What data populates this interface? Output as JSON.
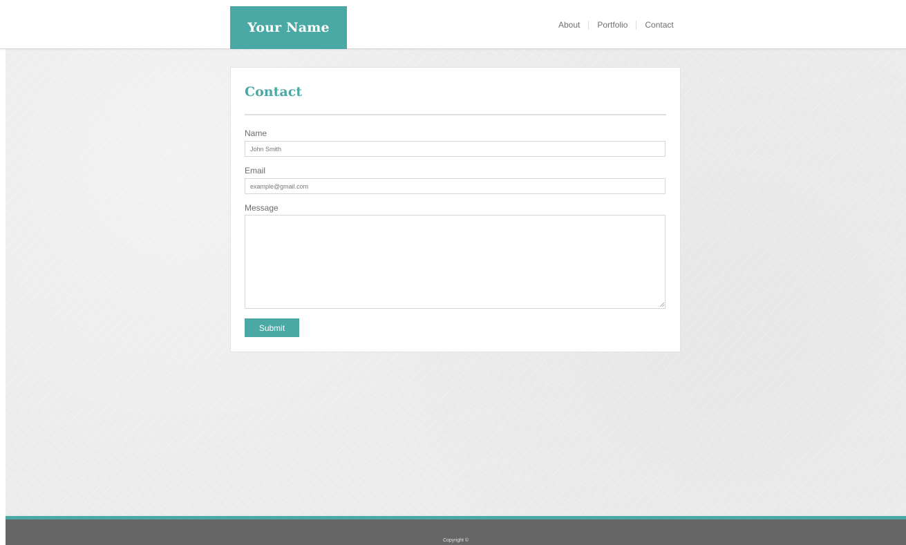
{
  "header": {
    "logo_text": "Your Name",
    "nav": [
      {
        "label": "About"
      },
      {
        "label": "Portfolio"
      },
      {
        "label": "Contact"
      }
    ]
  },
  "contact_form": {
    "title": "Contact",
    "name_label": "Name",
    "name_placeholder": "John Smith",
    "email_label": "Email",
    "email_placeholder": "example@gmail.com",
    "message_label": "Message",
    "message_value": "",
    "submit_label": "Submit"
  },
  "footer": {
    "copyright": "Copyright ©"
  },
  "colors": {
    "accent": "#4aa9a4",
    "footer_bg": "#666666",
    "page_bg": "#ececec"
  }
}
